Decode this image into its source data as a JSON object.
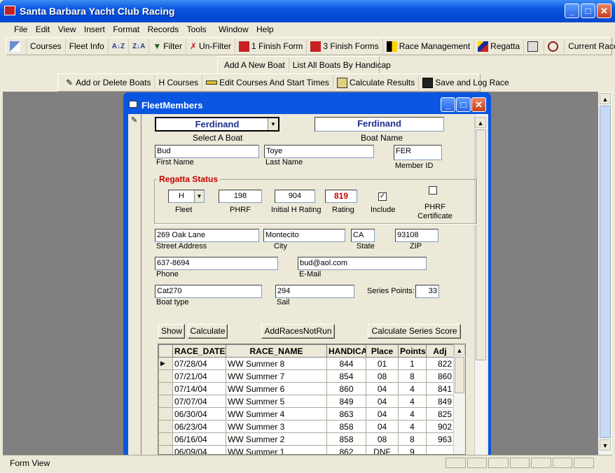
{
  "app": {
    "title": "Santa Barbara Yacht Club Racing",
    "status": "Form View"
  },
  "menu": [
    "File",
    "Edit",
    "View",
    "Insert",
    "Format",
    "Records",
    "Tools",
    "Window",
    "Help"
  ],
  "toolbar1": {
    "courses": "Courses",
    "fleet_info": "Fleet Info",
    "filter": "Filter",
    "unfilter": "Un-Filter",
    "finish1": "1 Finish Form",
    "finish3": "3 Finish Forms",
    "race_mgmt": "Race Management",
    "regatta": "Regatta",
    "current_race": "Current Race"
  },
  "toolbar2": {
    "add_boat": "Add A New Boat",
    "list_boats": "List All Boats By Handicap"
  },
  "toolbar3": {
    "add_delete": "Add or Delete Boats",
    "hcourses": "H Courses",
    "edit_courses": "Edit Courses And Start Times",
    "calc_results": "Calculate Results",
    "save_log": "Save and Log Race"
  },
  "form": {
    "title": "FleetMembers",
    "select_boat": "Ferdinand",
    "select_boat_label": "Select A Boat",
    "boat_name": "Ferdinand",
    "boat_name_label": "Boat Name",
    "first_name": "Bud",
    "first_name_label": "First Name",
    "last_name": "Toye",
    "last_name_label": "Last Name",
    "member_id": "FER",
    "member_id_label": "Member ID",
    "regatta_title": "Regatta Status",
    "fleet": "H",
    "fleet_label": "Fleet",
    "phrf": "198",
    "phrf_label": "PHRF",
    "initial_h": "904",
    "initial_h_label": "Initial H Rating",
    "rating": "819",
    "rating_label": "Rating",
    "include_label": "Include",
    "phrf_cert_label": "PHRF Certificate",
    "street": "269 Oak Lane",
    "street_label": "Street Address",
    "city": "Montecito",
    "city_label": "City",
    "state": "CA",
    "state_label": "State",
    "zip": "93108",
    "zip_label": "ZIP",
    "phone": "637-8694",
    "phone_label": "Phone",
    "email": "bud@aol.com",
    "email_label": "E-Mail",
    "boat_type": "Cat270",
    "boat_type_label": "Boat type",
    "sail": "294",
    "sail_label": "Sail",
    "series_points_label": "Series Points:",
    "series_points": "33",
    "btn_show": "Show",
    "btn_calculate": "Calculate",
    "btn_addraces": "AddRacesNotRun",
    "btn_calc_series": "Calculate Series Score"
  },
  "grid": {
    "headers": [
      "RACE_DATE",
      "RACE_NAME",
      "HANDICAP",
      "Place",
      "Points",
      "Adj"
    ],
    "rows": [
      [
        "07/28/04",
        "WW Summer 8",
        "844",
        "01",
        "1",
        "822"
      ],
      [
        "07/21/04",
        "WW Summer 7",
        "854",
        "08",
        "8",
        "860"
      ],
      [
        "07/14/04",
        "WW Summer 6",
        "860",
        "04",
        "4",
        "841"
      ],
      [
        "07/07/04",
        "WW Summer 5",
        "849",
        "04",
        "4",
        "849"
      ],
      [
        "06/30/04",
        "WW Summer 4",
        "863",
        "04",
        "4",
        "825"
      ],
      [
        "06/23/04",
        "WW Summer 3",
        "858",
        "04",
        "4",
        "902"
      ],
      [
        "06/16/04",
        "WW Summer 2",
        "858",
        "08",
        "8",
        "963"
      ],
      [
        "06/09/04",
        "WW Summer 1",
        "862",
        "DNF",
        "9",
        ""
      ]
    ]
  },
  "colors": {
    "titlebar": "#0a56e0",
    "regatta": "#cc0000",
    "boat_name": "#1f2f8f"
  }
}
